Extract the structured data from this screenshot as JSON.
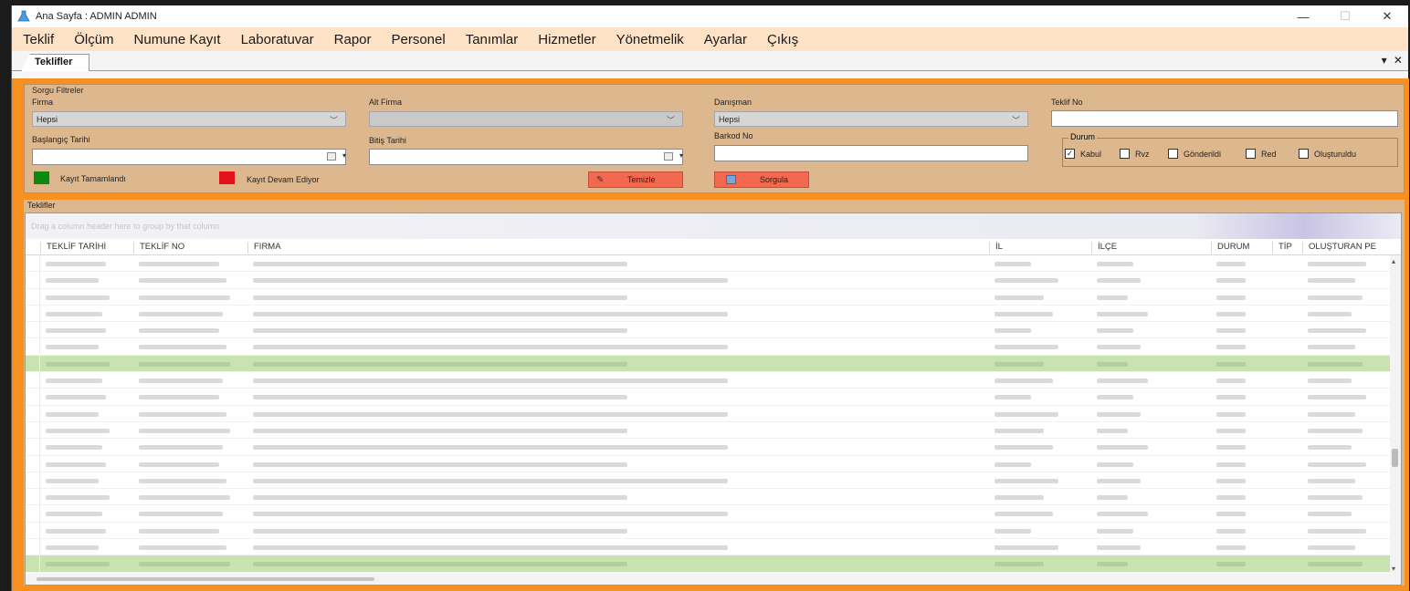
{
  "window": {
    "title": "Ana Sayfa : ADMIN ADMIN",
    "minimize": "—",
    "maximize": "☐",
    "close": "✕"
  },
  "menu": [
    "Teklif",
    "Ölçüm",
    "Numune Kayıt",
    "Laboratuvar",
    "Rapor",
    "Personel",
    "Tanımlar",
    "Hizmetler",
    "Yönetmelik",
    "Ayarlar",
    "Çıkış"
  ],
  "tab": {
    "label": "Teklifler",
    "controls": "▾ ✕"
  },
  "filters": {
    "group_title": "Sorgu Filtreler",
    "firma_label": "Firma",
    "firma_value": "Hepsi",
    "alt_firma_label": "Alt Firma",
    "alt_firma_value": "",
    "danisman_label": "Danışman",
    "danisman_value": "Hepsi",
    "teklif_no_label": "Teklif No",
    "teklif_no_value": "",
    "baslangic_label": "Başlangıç Tarihi",
    "bitis_label": "Bitiş Tarihi",
    "barkod_label": "Barkod No",
    "barkod_value": "",
    "legend_done": "Kayıt Tamamlandı",
    "legend_progress": "Kayıt Devam Ediyor",
    "clear_button": "Temizle",
    "query_button": "Sorgula",
    "durum_title": "Durum",
    "durum_options": [
      {
        "label": "Kabul",
        "checked": true
      },
      {
        "label": "Rvz",
        "checked": false
      },
      {
        "label": "Gönderildi",
        "checked": false
      },
      {
        "label": "Red",
        "checked": false
      },
      {
        "label": "Oluşturuldu",
        "checked": false
      }
    ]
  },
  "colors": {
    "done": "#0c8a10",
    "in_progress": "#e3121b",
    "frame": "#f7901e",
    "row_highlight": "#c9e3b0"
  },
  "grid": {
    "group_title": "Teklifler",
    "group_hint": "Drag a column header here to group by that column",
    "columns": [
      "TEKLİF TARİHİ",
      "TEKLİF NO",
      "FIRMA",
      "İL",
      "İLÇE",
      "DURUM",
      "TİP",
      "OLUŞTURAN PE"
    ],
    "rows": [
      {
        "highlight": false
      },
      {
        "highlight": false
      },
      {
        "highlight": false
      },
      {
        "highlight": false
      },
      {
        "highlight": false
      },
      {
        "highlight": false
      },
      {
        "highlight": true
      },
      {
        "highlight": false
      },
      {
        "highlight": false
      },
      {
        "highlight": false
      },
      {
        "highlight": false
      },
      {
        "highlight": false
      },
      {
        "highlight": false
      },
      {
        "highlight": false
      },
      {
        "highlight": false
      },
      {
        "highlight": false
      },
      {
        "highlight": false
      },
      {
        "highlight": false
      },
      {
        "highlight": true
      }
    ]
  }
}
